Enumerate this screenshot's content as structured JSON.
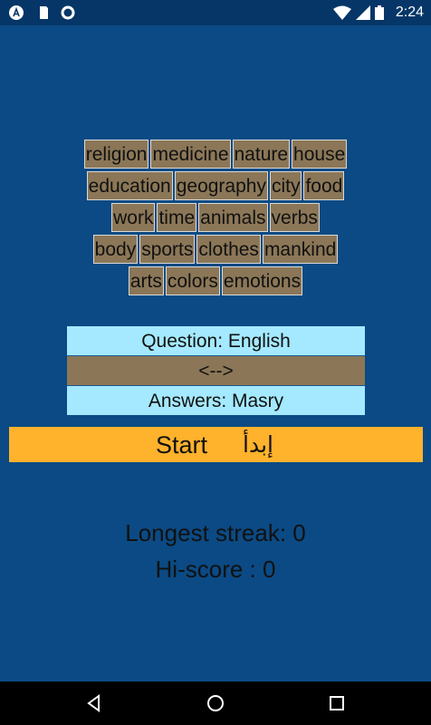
{
  "status_bar": {
    "time": "2:24",
    "left_icons": [
      "app-a-icon",
      "sd-card-icon",
      "circle-icon"
    ],
    "right_icons": [
      "wifi-icon",
      "signal-icon",
      "battery-icon"
    ]
  },
  "categories": {
    "rows": [
      [
        "religion",
        "medicine",
        "nature",
        "house"
      ],
      [
        "education",
        "geography",
        "city",
        "food"
      ],
      [
        "work",
        "time",
        "animals",
        "verbs"
      ],
      [
        "body",
        "sports",
        "clothes",
        "mankind"
      ],
      [
        "arts",
        "colors",
        "emotions"
      ]
    ]
  },
  "language": {
    "question": "Question: English",
    "swap": "<-->",
    "answers": "Answers: Masry"
  },
  "start": {
    "label_en": "Start",
    "label_ar": "إبدأ"
  },
  "stats": {
    "longest_streak": "Longest streak: 0",
    "hi_score": "Hi-score : 0"
  },
  "colors": {
    "background": "#0b4a84",
    "status_bar": "#053667",
    "category_tile": "#8b7757",
    "language_highlight": "#a4e9ff",
    "start_button": "#ffb22c"
  }
}
